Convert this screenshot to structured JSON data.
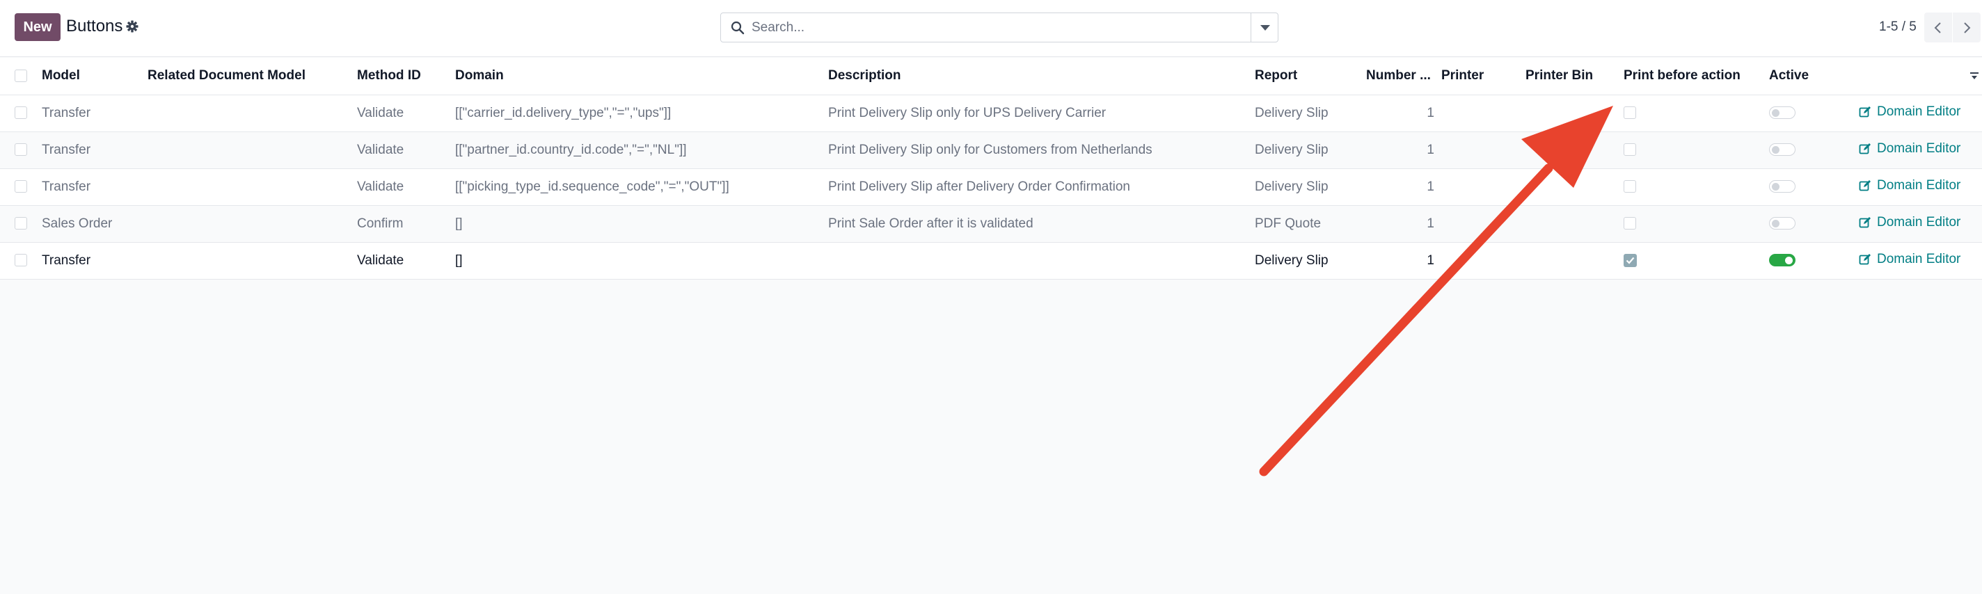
{
  "control_panel": {
    "new_label": "New",
    "title": "Buttons",
    "search_placeholder": "Search...",
    "pager": "1-5 / 5"
  },
  "table": {
    "headers": {
      "model": "Model",
      "related_model": "Related Document Model",
      "method_id": "Method ID",
      "domain": "Domain",
      "description": "Description",
      "report": "Report",
      "number": "Number ...",
      "printer": "Printer",
      "printer_bin": "Printer Bin",
      "print_before": "Print before action",
      "active": "Active"
    },
    "domain_editor_label": "Domain Editor",
    "rows": [
      {
        "model": "Transfer",
        "related_model": "",
        "method_id": "Validate",
        "domain": "[[\"carrier_id.delivery_type\",\"=\",\"ups\"]]",
        "description": "Print Delivery Slip only for UPS Delivery Carrier",
        "report": "Delivery Slip",
        "number": "1",
        "printer": "",
        "printer_bin": "",
        "print_before": false,
        "active": false
      },
      {
        "model": "Transfer",
        "related_model": "",
        "method_id": "Validate",
        "domain": "[[\"partner_id.country_id.code\",\"=\",\"NL\"]]",
        "description": "Print Delivery Slip only for Customers from Netherlands",
        "report": "Delivery Slip",
        "number": "1",
        "printer": "",
        "printer_bin": "",
        "print_before": false,
        "active": false
      },
      {
        "model": "Transfer",
        "related_model": "",
        "method_id": "Validate",
        "domain": "[[\"picking_type_id.sequence_code\",\"=\",\"OUT\"]]",
        "description": "Print Delivery Slip after Delivery Order Confirmation",
        "report": "Delivery Slip",
        "number": "1",
        "printer": "",
        "printer_bin": "",
        "print_before": false,
        "active": false
      },
      {
        "model": "Sales Order",
        "related_model": "",
        "method_id": "Confirm",
        "domain": "[]",
        "description": "Print Sale Order after it is validated",
        "report": "PDF Quote",
        "number": "1",
        "printer": "",
        "printer_bin": "",
        "print_before": false,
        "active": false
      },
      {
        "model": "Transfer",
        "related_model": "",
        "method_id": "Validate",
        "domain": "[]",
        "description": "",
        "report": "Delivery Slip",
        "number": "1",
        "printer": "",
        "printer_bin": "",
        "print_before": true,
        "active": true
      }
    ]
  },
  "colors": {
    "brand": "#714b67",
    "link": "#017e84",
    "toggle_on": "#28a745",
    "annotation": "#e8432d"
  }
}
